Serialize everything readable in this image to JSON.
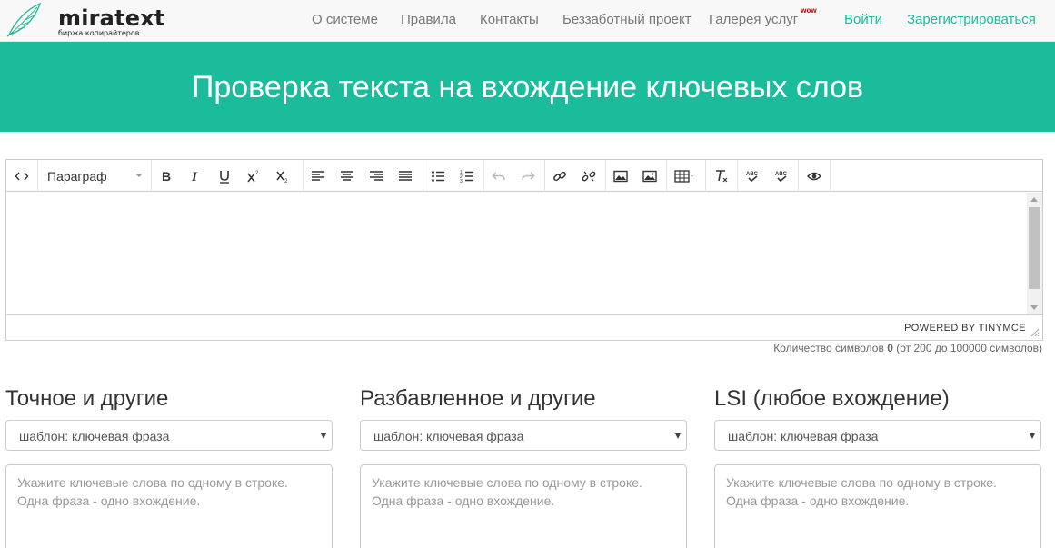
{
  "header": {
    "logo_name": "miratext",
    "logo_tagline": "биржа копирайтеров",
    "nav": [
      {
        "label": "О системе"
      },
      {
        "label": "Правила"
      },
      {
        "label": "Контакты"
      },
      {
        "label": "Беззаботный проект"
      },
      {
        "label": "Галерея услуг",
        "badge": "wow"
      },
      {
        "label": "Войти"
      },
      {
        "label": "Зарегистрироваться"
      }
    ]
  },
  "banner": {
    "title": "Проверка текста на вхождение ключевых слов"
  },
  "editor": {
    "format_value": "Параграф",
    "powered_by": "POWERED BY TINYMCE",
    "toolbar_icons": [
      "code-icon",
      "bold-icon",
      "italic-icon",
      "underline-icon",
      "superscript-icon",
      "subscript-icon",
      "align-left-icon",
      "align-center-icon",
      "align-right-icon",
      "align-justify-icon",
      "bullet-list-icon",
      "numbered-list-icon",
      "undo-icon",
      "redo-icon",
      "link-icon",
      "unlink-icon",
      "image-icon",
      "image-alt-icon",
      "table-icon",
      "clear-format-icon",
      "spellcheck-icon",
      "spellcheck-alt-icon",
      "preview-icon"
    ]
  },
  "counter": {
    "prefix": "Количество символов",
    "count": "0",
    "suffix": "(от 200 до 100000 символов)"
  },
  "columns": [
    {
      "title": "Точное и другие",
      "select_value": "шаблон: ключевая фраза",
      "placeholder_line1": "Укажите ключевые слова по одному в строке.",
      "placeholder_line2": "Одна фраза - одно вхождение."
    },
    {
      "title": "Разбавленное и другие",
      "select_value": "шаблон: ключевая фраза",
      "placeholder_line1": "Укажите ключевые слова по одному в строке.",
      "placeholder_line2": "Одна фраза - одно вхождение."
    },
    {
      "title": "LSI (любое вхождение)",
      "select_value": "шаблон: ключевая фраза",
      "placeholder_line1": "Укажите ключевые слова по одному в строке.",
      "placeholder_line2": "Одна фраза - одно вхождение."
    }
  ],
  "colors": {
    "brand": "#1abc9c",
    "badge": "#d10000"
  }
}
